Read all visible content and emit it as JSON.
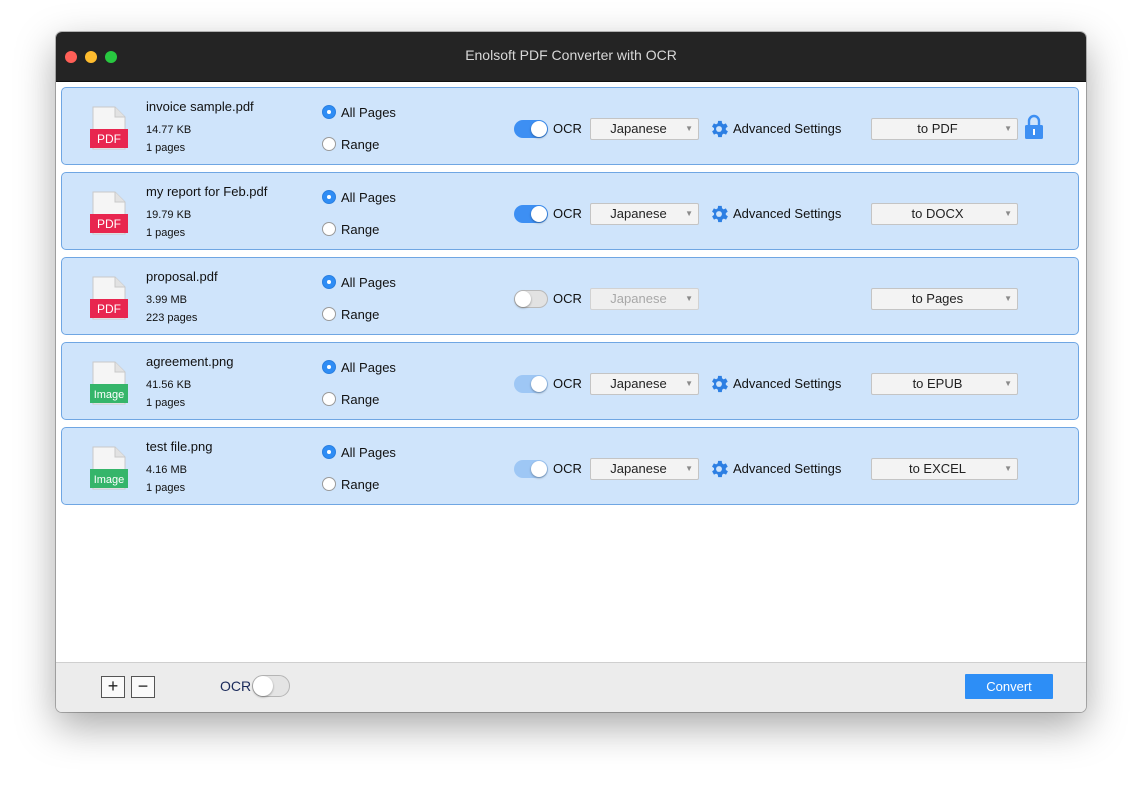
{
  "window": {
    "title": "Enolsoft PDF Converter with OCR"
  },
  "options": {
    "all_pages": "All Pages",
    "range": "Range",
    "ocr": "OCR",
    "advanced": "Advanced Settings"
  },
  "files": [
    {
      "name": "invoice sample.pdf",
      "size": "14.77 KB",
      "pages": "1 pages",
      "type_label": "PDF",
      "ocr_state": "on",
      "language": "Japanese",
      "format": "to PDF"
    },
    {
      "name": "my report for Feb.pdf",
      "size": "19.79 KB",
      "pages": "1 pages",
      "type_label": "PDF",
      "ocr_state": "on",
      "language": "Japanese",
      "format": "to DOCX"
    },
    {
      "name": "proposal.pdf",
      "size": "3.99 MB",
      "pages": "223 pages",
      "type_label": "PDF",
      "ocr_state": "off",
      "language": "Japanese",
      "format": "to Pages"
    },
    {
      "name": "agreement.png",
      "size": "41.56 KB",
      "pages": "1 pages",
      "type_label": "Image",
      "ocr_state": "on-locked",
      "language": "Japanese",
      "format": "to EPUB"
    },
    {
      "name": "test file.png",
      "size": "4.16 MB",
      "pages": "1 pages",
      "type_label": "Image",
      "ocr_state": "on-locked",
      "language": "Japanese",
      "format": "to EXCEL"
    }
  ],
  "bottom": {
    "add": "+",
    "remove": "−",
    "ocr_label": "OCR",
    "convert": "Convert"
  },
  "colors": {
    "pdf_badge": "#e8264f",
    "image_badge": "#35b56a",
    "accent": "#2d8ef6",
    "row_bg": "#cfe4fb"
  },
  "icons": {
    "gear": "gear-icon",
    "lock": "lock-icon"
  }
}
